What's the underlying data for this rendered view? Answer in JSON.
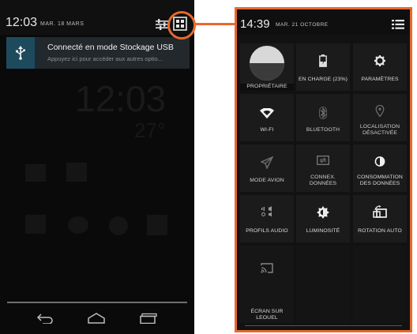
{
  "left_phone": {
    "status": {
      "time": "12:03",
      "date": "MAR. 18 MARS"
    },
    "notification": {
      "title": "Connecté en mode Stockage USB",
      "subtitle": "Appuyez ici pour accéder aux autres optio..."
    },
    "background": {
      "clock": "12:03",
      "temp": "27°"
    },
    "nav": {
      "back": "back-icon",
      "home": "home-icon",
      "recents": "recents-icon"
    }
  },
  "right_phone": {
    "status": {
      "time": "14:39",
      "date": "MAR. 21 OCTOBRE"
    },
    "tiles": [
      {
        "label": "PROPRIÉTAIRE",
        "icon": "avatar-icon"
      },
      {
        "label": "EN CHARGE (23%)",
        "icon": "battery-charging-icon"
      },
      {
        "label": "PARAMÈTRES",
        "icon": "gear-icon"
      },
      {
        "label": "WI-FI",
        "icon": "wifi-icon"
      },
      {
        "label": "BLUETOOTH",
        "icon": "bluetooth-icon"
      },
      {
        "label": "LOCALISATION",
        "label2": "DÉSACTIVÉE",
        "icon": "location-icon"
      },
      {
        "label": "MODE AVION",
        "icon": "airplane-icon"
      },
      {
        "label": "CONNEX.",
        "label2": "DONNÉES",
        "icon": "data-connection-icon"
      },
      {
        "label": "CONSOMMATION",
        "label2": "DES DONNÉES",
        "icon": "data-usage-icon"
      },
      {
        "label": "PROFILS AUDIO",
        "icon": "audio-profiles-icon"
      },
      {
        "label": "LUMINOSITÉ",
        "icon": "brightness-icon"
      },
      {
        "label": "ROTATION AUTO",
        "icon": "auto-rotate-icon"
      },
      {
        "label": "ÉCRAN SUR",
        "label2": "LEOUEL",
        "icon": "cast-screen-icon"
      }
    ]
  },
  "colors": {
    "highlight": "#e8692c",
    "tile": "#1b1b1b",
    "notif_icon_bg": "#1d4b5d"
  }
}
